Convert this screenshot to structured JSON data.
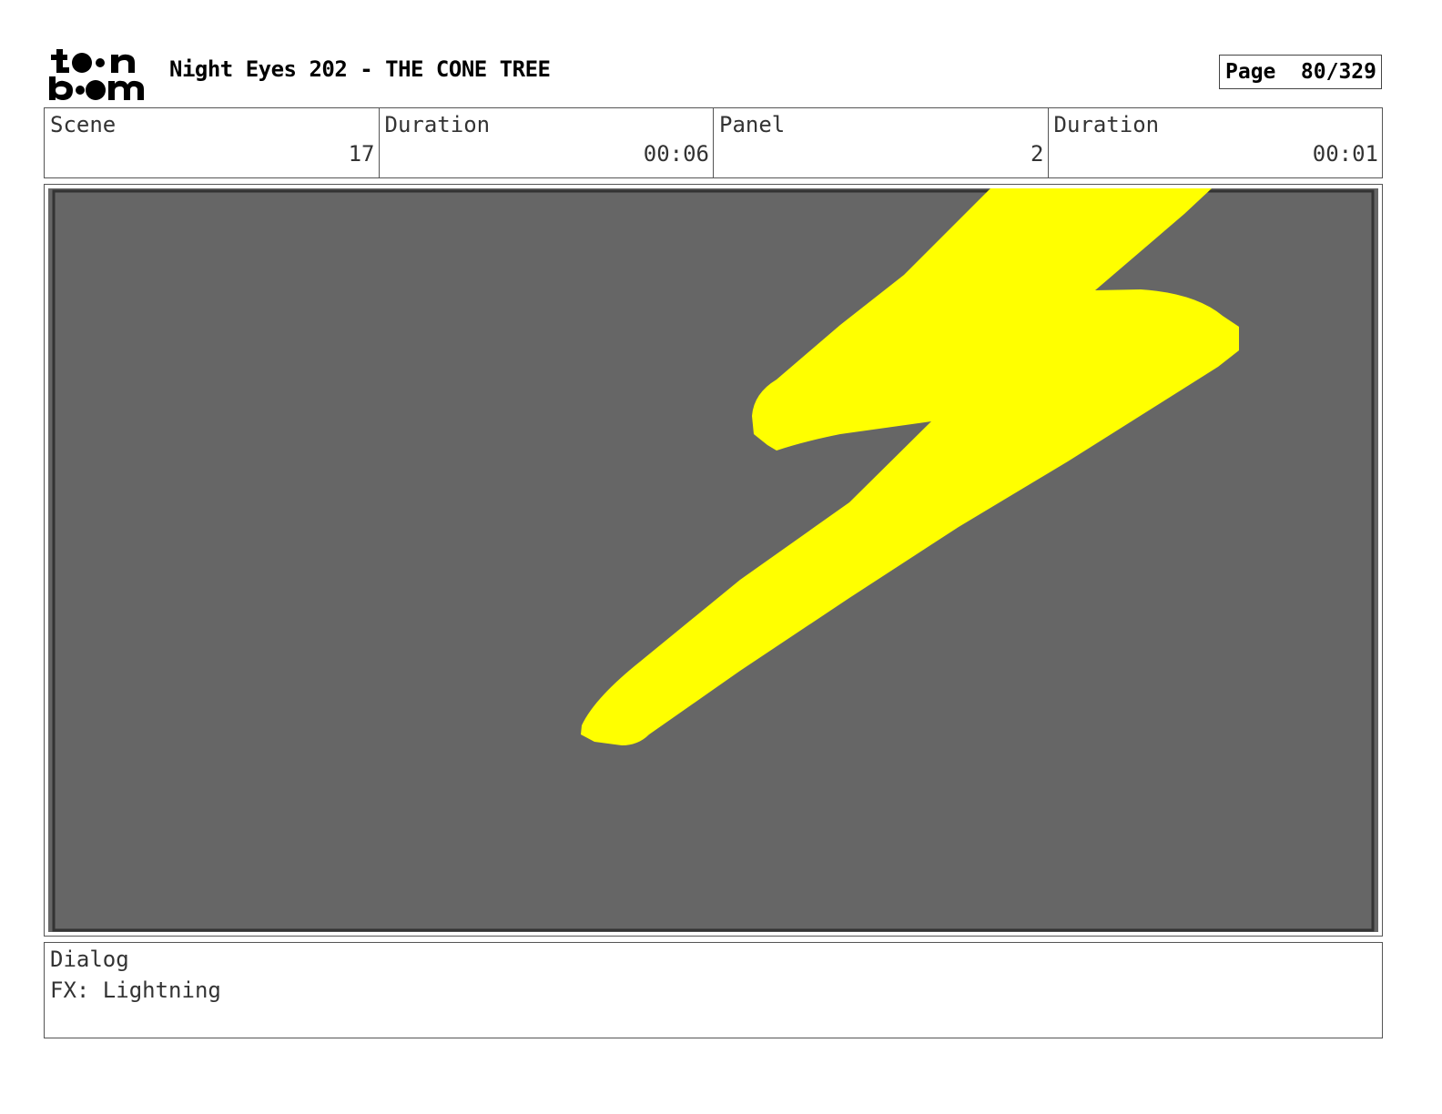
{
  "header": {
    "project_title": "Night Eyes 202 - THE CONE TREE",
    "page_label": "Page",
    "page_value": "80/329",
    "logo_text": "toon boom"
  },
  "info": {
    "scene": {
      "label": "Scene",
      "value": "17"
    },
    "scene_duration": {
      "label": "Duration",
      "value": "00:06"
    },
    "panel": {
      "label": "Panel",
      "value": "2"
    },
    "panel_duration": {
      "label": "Duration",
      "value": "00:01"
    }
  },
  "artwork": {
    "background_color": "#666666",
    "lightning_color": "#ffff00",
    "frame_color": "#333333"
  },
  "dialog": {
    "label": "Dialog",
    "text": "FX: Lightning"
  }
}
